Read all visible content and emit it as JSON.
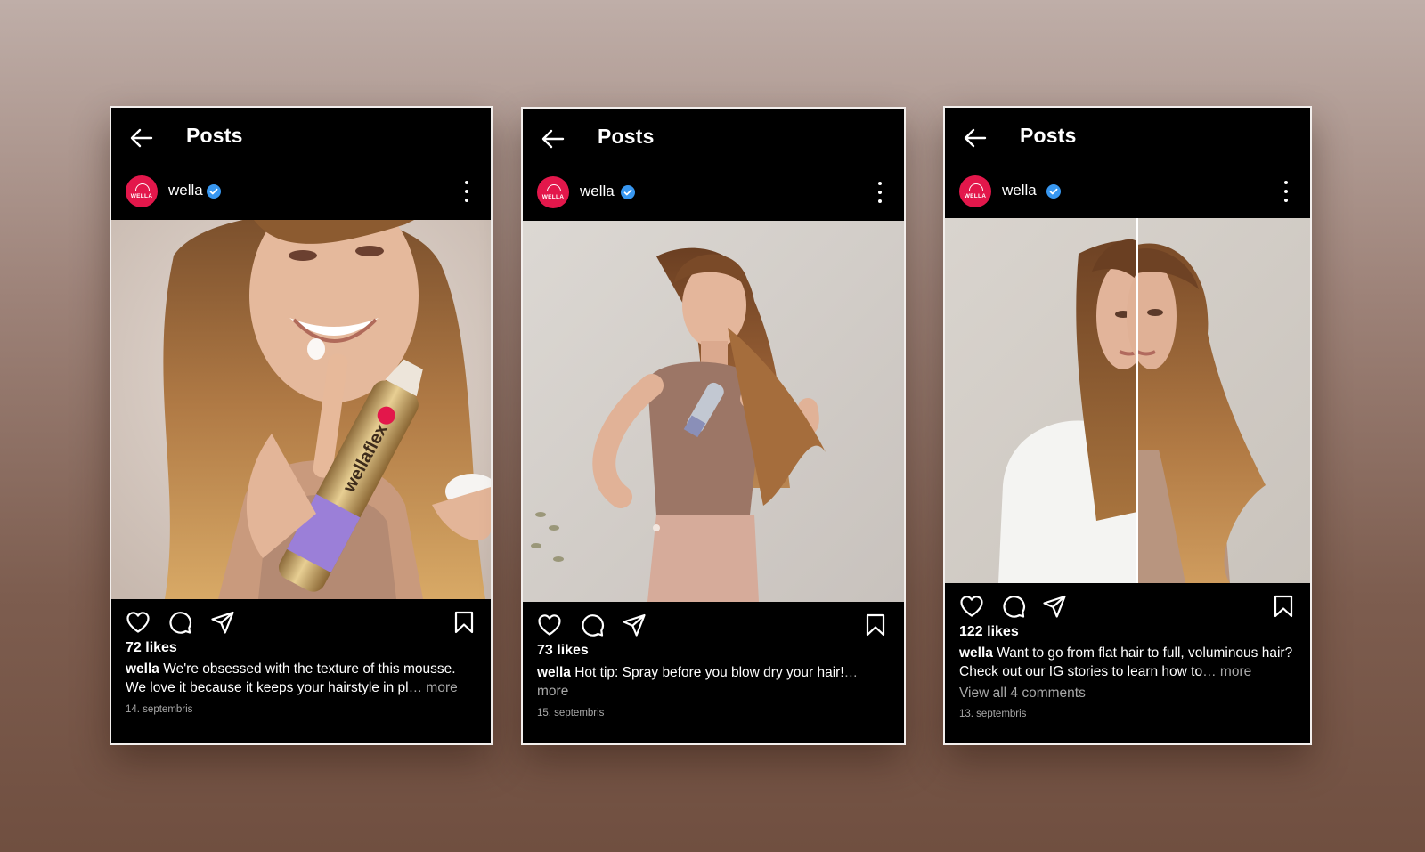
{
  "colors": {
    "brand_avatar": "#e3174b",
    "verified": "#3897f0",
    "card_bg": "#000000"
  },
  "posts": [
    {
      "header_title": "Posts",
      "username": "wella",
      "avatar_text": "WELLA",
      "likes": "72 likes",
      "caption_user": "wella",
      "caption_text": "We're obsessed with the texture of this mousse. We love it because it keeps your hairstyle in pl",
      "more_label": "… more",
      "comments_link": "",
      "date": "14. septembris",
      "product_text": "wellaflex"
    },
    {
      "header_title": "Posts",
      "username": "wella",
      "avatar_text": "WELLA",
      "likes": "73 likes",
      "caption_user": "wella",
      "caption_text": "Hot tip: Spray before you blow dry your hair!",
      "more_label": "… more",
      "comments_link": "",
      "date": "15. septembris"
    },
    {
      "header_title": "Posts",
      "username": "wella",
      "avatar_text": "WELLA",
      "likes": "122 likes",
      "caption_user": "wella",
      "caption_text": "Want to go from flat hair to full, voluminous hair? Check out our IG stories to learn how to",
      "more_label": "… more",
      "comments_link": "View all 4 comments",
      "date": "13. septembris"
    }
  ]
}
